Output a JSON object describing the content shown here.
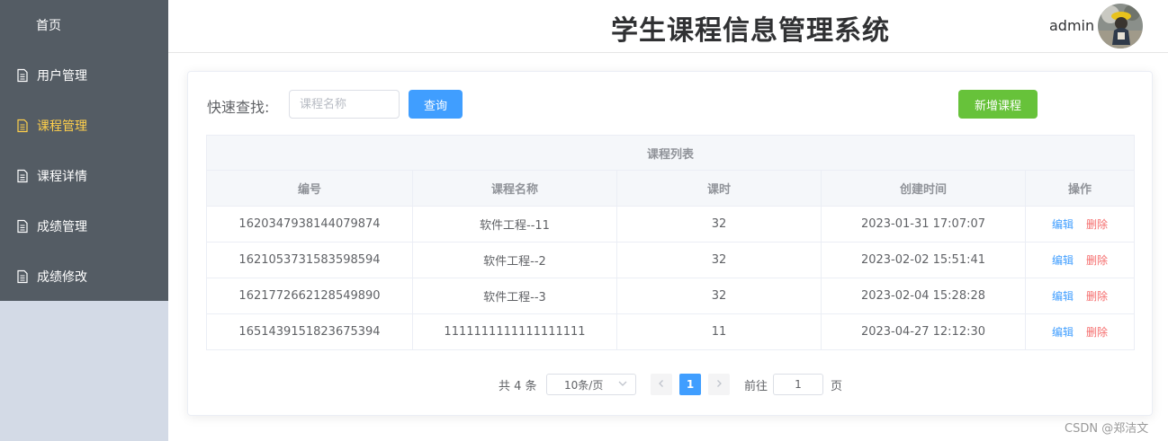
{
  "sidebar": {
    "items": [
      {
        "label": "首页",
        "icon": "none",
        "active": false
      },
      {
        "label": "用户管理",
        "icon": "document-icon",
        "active": false
      },
      {
        "label": "课程管理",
        "icon": "document-icon",
        "active": true
      },
      {
        "label": "课程详情",
        "icon": "document-icon",
        "active": false
      },
      {
        "label": "成绩管理",
        "icon": "document-icon",
        "active": false
      },
      {
        "label": "成绩修改",
        "icon": "document-icon",
        "active": false
      }
    ],
    "bg_color": "#545c64",
    "active_color": "#ffd04b"
  },
  "header": {
    "title": "学生课程信息管理系统",
    "username": "admin"
  },
  "search": {
    "label": "快速查找:",
    "placeholder": "课程名称",
    "value": "",
    "query_button": "查询",
    "add_button": "新增课程"
  },
  "table": {
    "caption": "课程列表",
    "columns": [
      "编号",
      "课程名称",
      "课时",
      "创建时间",
      "操作"
    ],
    "rows": [
      {
        "id": "1620347938144079874",
        "name": "软件工程--11",
        "hours": "32",
        "created": "2023-01-31 17:07:07"
      },
      {
        "id": "1621053731583598594",
        "name": "软件工程--2",
        "hours": "32",
        "created": "2023-02-02 15:51:41"
      },
      {
        "id": "1621772662128549890",
        "name": "软件工程--3",
        "hours": "32",
        "created": "2023-02-04 15:28:28"
      },
      {
        "id": "1651439151823675394",
        "name": "1111111111111111111",
        "hours": "11",
        "created": "2023-04-27 12:12:30"
      }
    ],
    "edit_label": "编辑",
    "delete_label": "删除"
  },
  "pagination": {
    "total_text": "共 4 条",
    "page_size": "10条/页",
    "current_page": "1",
    "goto_label": "前往",
    "goto_value": "1",
    "goto_unit": "页"
  },
  "watermark": "CSDN @郑洁文",
  "colors": {
    "primary": "#409eff",
    "success": "#67c23a",
    "danger": "#f56c6c"
  }
}
